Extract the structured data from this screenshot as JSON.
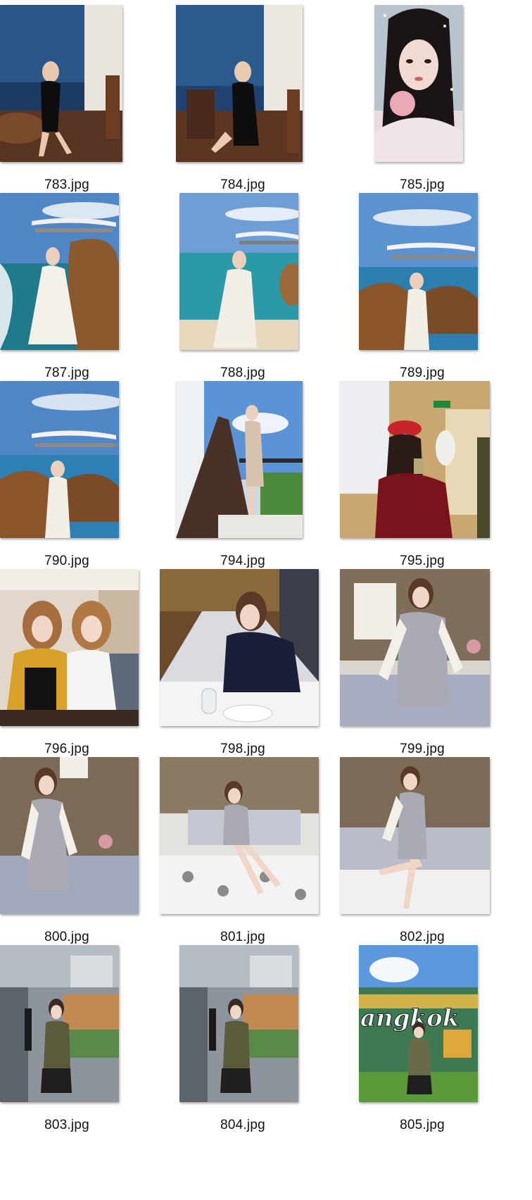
{
  "files": [
    {
      "name": "783.jpg",
      "scene": "interior-blue"
    },
    {
      "name": "784.jpg",
      "scene": "interior-blue"
    },
    {
      "name": "785.jpg",
      "scene": "portrait-snow"
    },
    {
      "name": "787.jpg",
      "scene": "beach-wave"
    },
    {
      "name": "788.jpg",
      "scene": "beach-clear"
    },
    {
      "name": "789.jpg",
      "scene": "beach-rocks"
    },
    {
      "name": "790.jpg",
      "scene": "beach-rocks"
    },
    {
      "name": "794.jpg",
      "scene": "balcony"
    },
    {
      "name": "795.jpg",
      "scene": "studio-red"
    },
    {
      "name": "796.jpg",
      "scene": "two-girls"
    },
    {
      "name": "798.jpg",
      "scene": "restaurant"
    },
    {
      "name": "799.jpg",
      "scene": "sofa-room"
    },
    {
      "name": "800.jpg",
      "scene": "sofa-room"
    },
    {
      "name": "801.jpg",
      "scene": "sofa-room"
    },
    {
      "name": "802.jpg",
      "scene": "sofa-room"
    },
    {
      "name": "803.jpg",
      "scene": "shooting-range"
    },
    {
      "name": "804.jpg",
      "scene": "shooting-range"
    },
    {
      "name": "805.jpg",
      "scene": "bangkok-sign"
    }
  ],
  "bangkok_sign_text": "angkok"
}
